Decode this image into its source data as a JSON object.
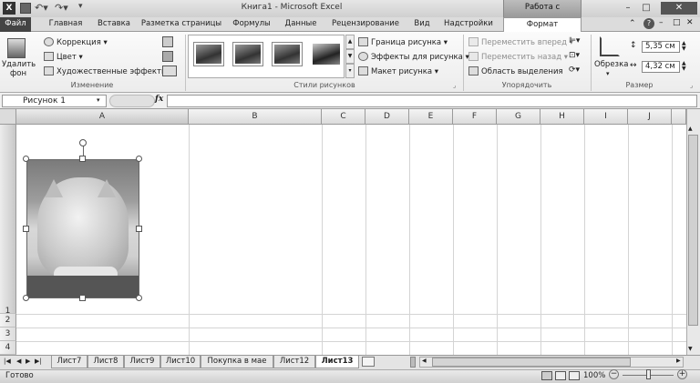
{
  "app": {
    "title": "Книга1 - Microsoft Excel",
    "context_title": "Работа с рисунками"
  },
  "tabs": {
    "file": "Файл",
    "home": "Главная",
    "insert": "Вставка",
    "page_layout": "Разметка страницы",
    "formulas": "Формулы",
    "data": "Данные",
    "review": "Рецензирование",
    "view": "Вид",
    "addins": "Надстройки",
    "format": "Формат"
  },
  "ribbon": {
    "remove_bg": "Удалить фон",
    "correction": "Коррекция",
    "color": "Цвет",
    "effects": "Художественные эффекты",
    "group_change": "Изменение",
    "group_styles": "Стили рисунков",
    "border": "Граница рисунка",
    "pic_effects": "Эффекты для рисунка",
    "layout": "Макет рисунка",
    "bring_forward": "Переместить вперед",
    "send_backward": "Переместить назад",
    "selection_pane": "Область выделения",
    "group_arrange": "Упорядочить",
    "crop": "Обрезка",
    "height": "5,35 см",
    "width": "4,32 см",
    "group_size": "Размер"
  },
  "formula": {
    "name": "Рисунок 1",
    "fx": "fx",
    "value": ""
  },
  "columns": [
    "A",
    "B",
    "C",
    "D",
    "E",
    "F",
    "G",
    "H",
    "I",
    "J"
  ],
  "rows": [
    "1",
    "2",
    "3",
    "4"
  ],
  "sheets": [
    "Лист7",
    "Лист8",
    "Лист9",
    "Лист10",
    "Покупка в мае",
    "Лист12",
    "Лист13"
  ],
  "active_sheet": "Лист13",
  "status": {
    "ready": "Готово",
    "zoom": "100%",
    "minus": "−",
    "plus": "+"
  },
  "window": {
    "minimize": "–",
    "maximize": "□",
    "close": "✕",
    "help": "?"
  }
}
